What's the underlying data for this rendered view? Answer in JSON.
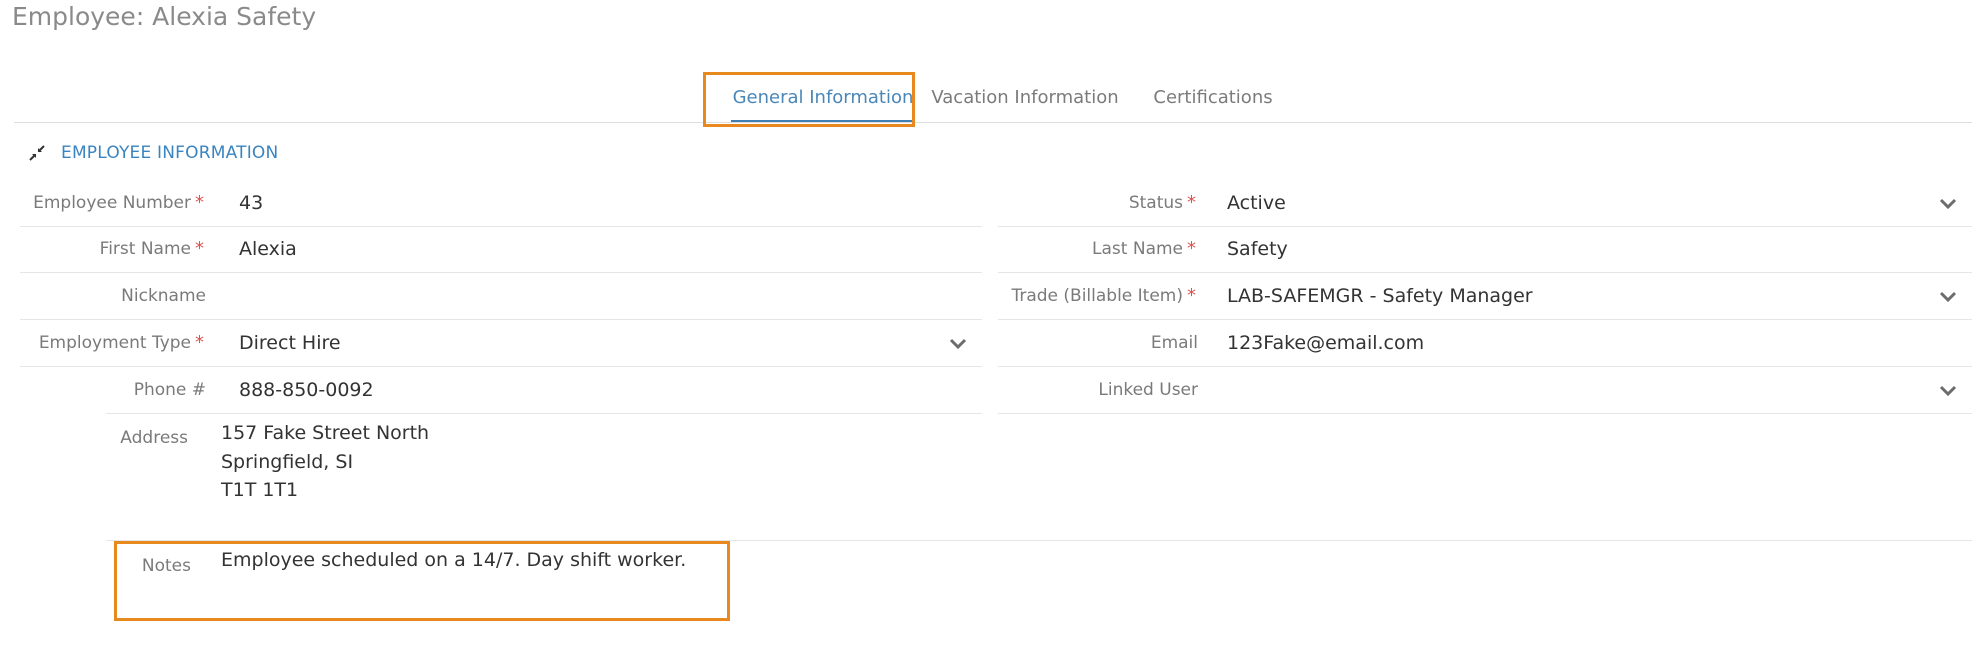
{
  "page": {
    "title": "Employee: Alexia Safety"
  },
  "tabs": [
    {
      "label": "General Information",
      "active": true
    },
    {
      "label": "Vacation Information",
      "active": false
    },
    {
      "label": "Certifications",
      "active": false
    }
  ],
  "section": {
    "icon": "collapse-arrows-icon",
    "title": "EMPLOYEE INFORMATION"
  },
  "fields": {
    "employee_number": {
      "label": "Employee Number",
      "value": "43",
      "required": true
    },
    "first_name": {
      "label": "First Name",
      "value": "Alexia",
      "required": true
    },
    "nickname": {
      "label": "Nickname",
      "value": "",
      "required": false
    },
    "employment_type": {
      "label": "Employment Type",
      "value": "Direct Hire",
      "required": true
    },
    "phone": {
      "label": "Phone #",
      "value": "888-850-0092",
      "required": false
    },
    "status": {
      "label": "Status",
      "value": "Active",
      "required": true
    },
    "last_name": {
      "label": "Last Name",
      "value": "Safety",
      "required": true
    },
    "trade": {
      "label": "Trade (Billable Item)",
      "value": "LAB-SAFEMGR - Safety Manager",
      "required": true
    },
    "email": {
      "label": "Email",
      "value": "123Fake@email.com",
      "required": false
    },
    "linked_user": {
      "label": "Linked User",
      "value": "",
      "required": false
    },
    "address": {
      "label": "Address",
      "lines": [
        "157 Fake Street North",
        "Springfield, SI",
        "T1T 1T1"
      ]
    },
    "notes": {
      "label": "Notes",
      "value": "Employee scheduled on a 14/7. Day shift worker."
    }
  },
  "required_marker": "*",
  "colors": {
    "accent": "#3a84bf",
    "highlight": "#e8891f",
    "required": "#d9534f"
  }
}
